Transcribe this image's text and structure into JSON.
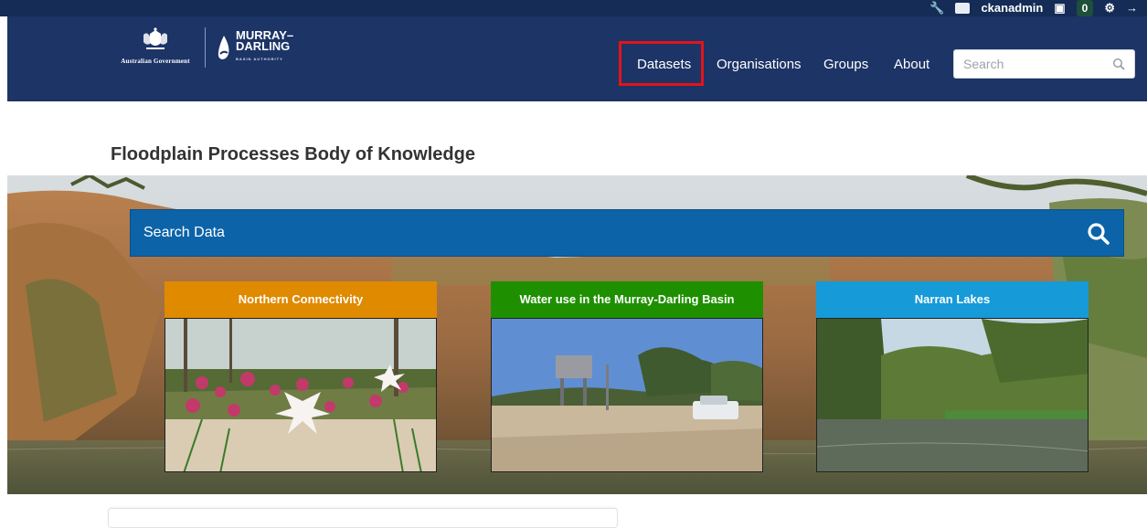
{
  "account": {
    "username": "ckanadmin",
    "dashboard_count": "0"
  },
  "header": {
    "gov_logo_text": "Australian Government",
    "mdba_line1": "MURRAY–",
    "mdba_line2": "DARLING",
    "mdba_sub": "BASIN AUTHORITY",
    "nav": [
      "Datasets",
      "Organisations",
      "Groups",
      "About"
    ],
    "search_placeholder": "Search"
  },
  "page": {
    "title": "Floodplain Processes Body of Knowledge"
  },
  "hero": {
    "search_label": "Search Data",
    "cards": [
      {
        "title": "Northern Connectivity",
        "color": "#e08a00"
      },
      {
        "title": "Water use in the Murray-Darling Basin",
        "color": "#1e9000"
      },
      {
        "title": "Narran Lakes",
        "color": "#169ad8"
      }
    ]
  },
  "colors": {
    "masthead": "#1c3466",
    "highlight": "#e3141a",
    "search_bar": "#0c63a8"
  }
}
